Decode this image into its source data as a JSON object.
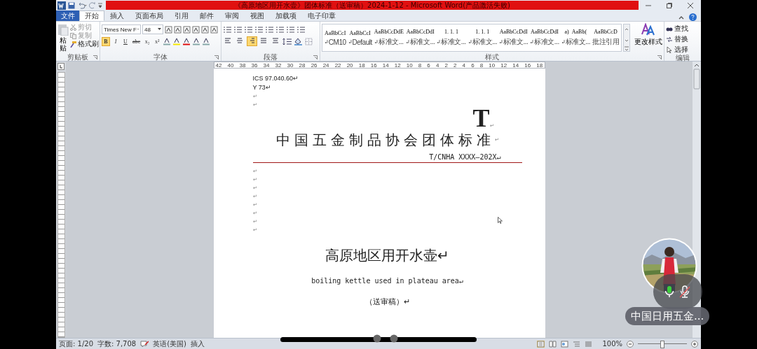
{
  "window": {
    "title": "《高原地区用开水壶》团体标准（送审稿）2024-1-12 - Microsoft Word(产品激活失败)"
  },
  "tabs": [
    {
      "label": "文件",
      "kind": "file",
      "selected": false
    },
    {
      "label": "开始",
      "kind": "tab",
      "selected": true
    },
    {
      "label": "插入",
      "kind": "tab",
      "selected": false
    },
    {
      "label": "页面布局",
      "kind": "tab",
      "selected": false
    },
    {
      "label": "引用",
      "kind": "tab",
      "selected": false
    },
    {
      "label": "邮件",
      "kind": "tab",
      "selected": false
    },
    {
      "label": "审阅",
      "kind": "tab",
      "selected": false
    },
    {
      "label": "视图",
      "kind": "tab",
      "selected": false
    },
    {
      "label": "加载项",
      "kind": "tab",
      "selected": false
    },
    {
      "label": "电子印章",
      "kind": "tab",
      "selected": false
    }
  ],
  "clipboard": {
    "paste": "粘贴",
    "cut": "剪切",
    "copy": "复制",
    "format_painter": "格式刷",
    "group": "剪贴板"
  },
  "font": {
    "name": "Times New F",
    "size": "48",
    "group": "字体",
    "format_buttons": [
      {
        "label": "B",
        "kind": "bold",
        "selected": true
      },
      {
        "label": "I",
        "kind": "italic",
        "selected": false
      },
      {
        "label": "U",
        "kind": "underline",
        "selected": false
      },
      {
        "label": "abc",
        "kind": "strike",
        "selected": false
      },
      {
        "label": "x₂",
        "kind": "plain",
        "selected": false
      },
      {
        "label": "x²",
        "kind": "plain",
        "selected": false
      }
    ]
  },
  "paragraph": {
    "group": "段落",
    "alignments": [
      {
        "selected": false
      },
      {
        "selected": false
      },
      {
        "selected": true
      },
      {
        "selected": false
      },
      {
        "selected": false
      }
    ]
  },
  "styles": {
    "group": "样式",
    "items": [
      {
        "preview": "AaBbCcI",
        "name": "CM10",
        "kind": "paragraph"
      },
      {
        "preview": "AaBbCcI",
        "name": "Default",
        "kind": "paragraph"
      },
      {
        "preview": "AaBbCcDdE",
        "name": "标准文...",
        "kind": "paragraph"
      },
      {
        "preview": "AaBbCcDdI",
        "name": "标准文...",
        "kind": "paragraph"
      },
      {
        "preview": "1. 1. 1",
        "name": "标准文...",
        "kind": "paragraph"
      },
      {
        "preview": "1. 1. 1",
        "name": "标准文...",
        "kind": "paragraph"
      },
      {
        "preview": "AaBbCcDdI",
        "name": "标准文...",
        "kind": "paragraph"
      },
      {
        "preview": "AaBbCcDdI",
        "name": "标准文...",
        "kind": "paragraph"
      },
      {
        "preview": "a)",
        "preview_2": "AaBb(",
        "name": "标准文...",
        "kind": "paragraph"
      },
      {
        "preview": "AaBbCcD",
        "name": "批注引用",
        "kind": "character"
      }
    ]
  },
  "change_styles": "更改样式",
  "editing": {
    "group": "编辑",
    "items": [
      {
        "label": "查找",
        "kind": "find"
      },
      {
        "label": "替换",
        "kind": "replace"
      },
      {
        "label": "选择",
        "kind": "select"
      }
    ]
  },
  "ruler": {
    "labels": [
      "42",
      "40",
      "38",
      "36",
      "34",
      "32",
      "30",
      "28",
      "26",
      "24",
      "22",
      "20",
      "18",
      "16",
      "14",
      "12",
      "10",
      "8",
      "6",
      "4",
      "2",
      "2",
      "4",
      "6",
      "8",
      "10",
      "12",
      "14",
      "16",
      "18"
    ]
  },
  "document": {
    "lines": [
      {
        "kind": "small",
        "text": "ICS 97.040.60↵"
      },
      {
        "kind": "small",
        "text": "Y 73↵"
      },
      {
        "kind": "blank",
        "text": "↵"
      },
      {
        "kind": "blank",
        "text": "↵"
      },
      {
        "kind": "big-letter",
        "text": "T",
        "mark": "↵"
      },
      {
        "kind": "org-title",
        "text": "中国五金制品协会团体标准",
        "mark": "↵"
      },
      {
        "kind": "code",
        "text": "T/CNHA XXXX—202X↵"
      },
      {
        "kind": "rule"
      },
      {
        "kind": "blank",
        "text": "↵"
      },
      {
        "kind": "blank",
        "text": "↵"
      },
      {
        "kind": "blank",
        "text": "↵"
      },
      {
        "kind": "blank",
        "text": "↵"
      },
      {
        "kind": "blank",
        "text": "↵"
      },
      {
        "kind": "blank",
        "text": "↵"
      },
      {
        "kind": "blank",
        "text": "↵"
      },
      {
        "kind": "blank",
        "text": "↵"
      },
      {
        "kind": "doc-title",
        "text": "高原地区用开水壶↵"
      },
      {
        "kind": "english",
        "text": "boiling kettle used in plateau area↵"
      },
      {
        "kind": "draft",
        "text": "（送审稿）↵"
      }
    ]
  },
  "status_bar": {
    "page": "页面: 1/20",
    "words": "字数: 7,708",
    "language": "英语(美国)",
    "mode": "插入",
    "zoom": "100%",
    "level": 0.5
  },
  "call_overlay": {
    "name": "中国日用五金..."
  }
}
